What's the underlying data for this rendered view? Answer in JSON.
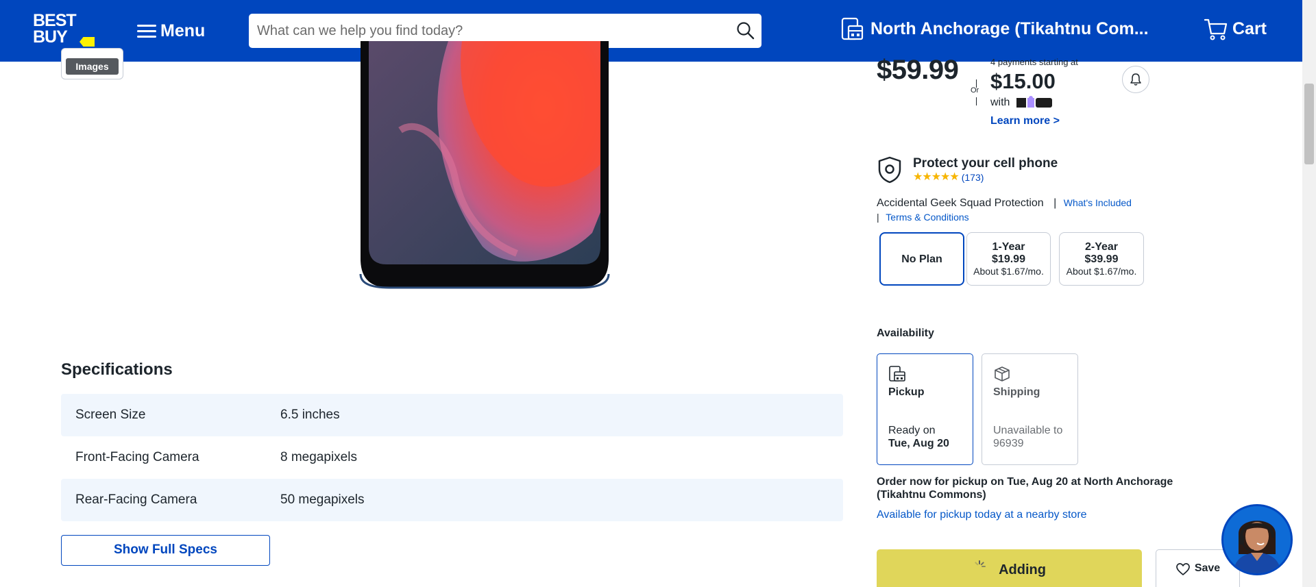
{
  "header": {
    "logo_text_line1": "BEST",
    "logo_text_line2": "BUY",
    "menu_label": "Menu",
    "search_placeholder": "What can we help you find today?",
    "store_name": "North Anchorage (Tikahtnu Com...",
    "cart_label": "Cart",
    "colors": {
      "bar": "#0046be",
      "tag": "#fff200"
    }
  },
  "media": {
    "images_label": "Images"
  },
  "specs": {
    "title": "Specifications",
    "rows": [
      {
        "label": "Screen Size",
        "value": "6.5 inches"
      },
      {
        "label": "Front-Facing Camera",
        "value": "8 megapixels"
      },
      {
        "label": "Rear-Facing Camera",
        "value": "50 megapixels"
      }
    ],
    "show_full_label": "Show Full Specs"
  },
  "pricing": {
    "price": "$59.99",
    "or_label": "Or",
    "zip_note": "4 payments starting at",
    "zip_amount": "$15.00",
    "zip_with": "with",
    "zip_brand": "zip",
    "learn_more": "Learn more >"
  },
  "protection": {
    "title": "Protect your cell phone",
    "rating": 4.5,
    "review_count": "(173)",
    "plan_name": "Accidental Geek Squad Protection",
    "whats_included": "What's Included",
    "terms": "Terms & Conditions",
    "plans": [
      {
        "name": "No Plan",
        "price": "",
        "monthly": "",
        "selected": true
      },
      {
        "name": "1-Year",
        "price": "$19.99",
        "monthly": "About $1.67/mo.",
        "selected": false
      },
      {
        "name": "2-Year",
        "price": "$39.99",
        "monthly": "About $1.67/mo.",
        "selected": false
      }
    ]
  },
  "availability": {
    "title": "Availability",
    "pickup": {
      "title": "Pickup",
      "line1": "Ready on",
      "line2": "Tue, Aug 20"
    },
    "shipping": {
      "title": "Shipping",
      "line1": "Unavailable to",
      "line2": "96939"
    },
    "order_note": "Order now for pickup on Tue, Aug 20 at North Anchorage (Tikahtnu Commons)",
    "nearby_link": "Available for pickup today at a nearby store"
  },
  "actions": {
    "add_label": "Adding",
    "save_label": "Save",
    "add_color": "#e0d65a"
  }
}
